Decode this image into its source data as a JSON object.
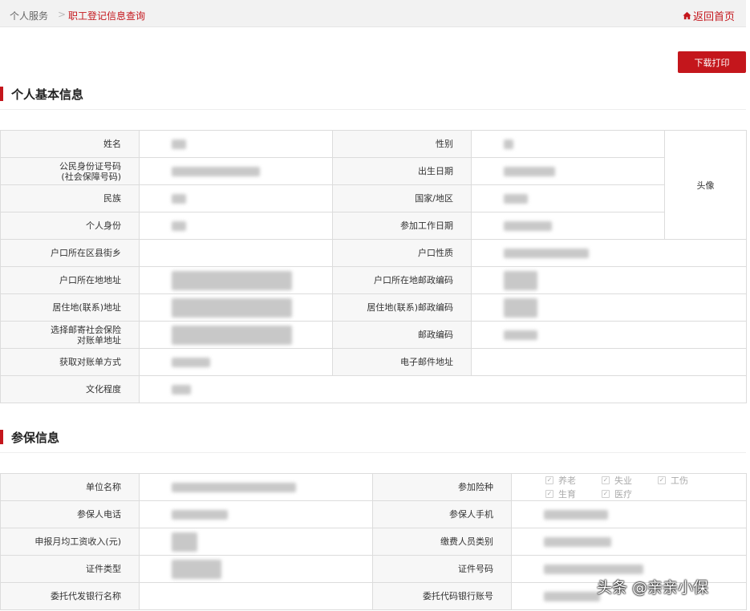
{
  "breadcrumb": {
    "root": "个人服务",
    "separator": ">",
    "current": "职工登记信息查询"
  },
  "header": {
    "home_label": "返回首页"
  },
  "toolbar": {
    "print_label": "下载打印"
  },
  "sections": {
    "basic_title": "个人基本信息",
    "insurance_title": "参保信息"
  },
  "basic_info": {
    "name": "姓名",
    "gender": "性别",
    "id_number_1": "公民身份证号码",
    "id_number_2": "(社会保障号码)",
    "birth_date": "出生日期",
    "ethnicity": "民族",
    "country": "国家/地区",
    "identity": "个人身份",
    "work_start": "参加工作日期",
    "hukou_district": "户口所在区县街乡",
    "hukou_type": "户口性质",
    "hukou_address": "户口所在地地址",
    "hukou_postcode": "户口所在地邮政编码",
    "residence_address": "居住地(联系)地址",
    "residence_postcode": "居住地(联系)邮政编码",
    "mail_address_1": "选择邮寄社会保险",
    "mail_address_2": "对账单地址",
    "postcode": "邮政编码",
    "statement_method": "获取对账单方式",
    "email": "电子邮件地址",
    "education": "文化程度",
    "avatar": "头像"
  },
  "insurance_info": {
    "employer": "单位名称",
    "insurance_types": "参加险种",
    "phone": "参保人电话",
    "mobile": "参保人手机",
    "monthly_income": "申报月均工资收入(元)",
    "payer_category": "缴费人员类别",
    "doc_type": "证件类型",
    "doc_number": "证件号码",
    "bank_name": "委托代发银行名称",
    "bank_account": "委托代码银行账号",
    "types": [
      {
        "label": "养老",
        "checked": true
      },
      {
        "label": "失业",
        "checked": true
      },
      {
        "label": "工伤",
        "checked": true
      },
      {
        "label": "生育",
        "checked": true
      },
      {
        "label": "医疗",
        "checked": true
      }
    ]
  },
  "watermark": "头条 @亲亲小保",
  "colors": {
    "accent": "#c4161c",
    "label_bg": "#f7f7f7",
    "border": "#dcdcdc"
  }
}
